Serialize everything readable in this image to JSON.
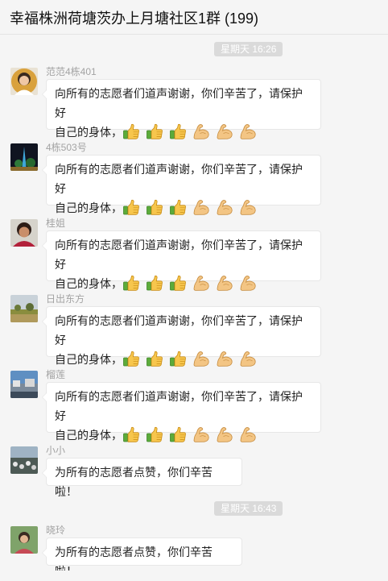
{
  "header": {
    "title": "幸福株洲荷塘茨办上月塘社区1群 (199)"
  },
  "time_badges": [
    "星期天 16:26",
    "星期天 16:43"
  ],
  "messages": [
    {
      "sender": "范范4栋401",
      "line1": "向所有的志愿者们道声谢谢，你们辛苦了，请保护好",
      "line2": "自己的身体，",
      "emoji": [
        "thumbs-up",
        "thumbs-up",
        "thumbs-up",
        "flexed-biceps",
        "flexed-biceps",
        "flexed-biceps"
      ]
    },
    {
      "sender": "4栋503号",
      "line1": "向所有的志愿者们道声谢谢，你们辛苦了，请保护好",
      "line2": "自己的身体，",
      "emoji": [
        "thumbs-up",
        "thumbs-up",
        "thumbs-up",
        "flexed-biceps",
        "flexed-biceps",
        "flexed-biceps"
      ]
    },
    {
      "sender": "桂姐",
      "line1": "向所有的志愿者们道声谢谢，你们辛苦了，请保护好",
      "line2": "自己的身体，",
      "emoji": [
        "thumbs-up",
        "thumbs-up",
        "thumbs-up",
        "flexed-biceps",
        "flexed-biceps",
        "flexed-biceps"
      ]
    },
    {
      "sender": "日出东方",
      "line1": "向所有的志愿者们道声谢谢，你们辛苦了，请保护好",
      "line2": "自己的身体，",
      "emoji": [
        "thumbs-up",
        "thumbs-up",
        "thumbs-up",
        "flexed-biceps",
        "flexed-biceps",
        "flexed-biceps"
      ]
    },
    {
      "sender": "榴莲",
      "line1": "向所有的志愿者们道声谢谢，你们辛苦了，请保护好",
      "line2": "自己的身体，",
      "emoji": [
        "thumbs-up",
        "thumbs-up",
        "thumbs-up",
        "flexed-biceps",
        "flexed-biceps",
        "flexed-biceps"
      ]
    },
    {
      "sender": "小小",
      "text": "为所有的志愿者点赞，你们辛苦啦！"
    },
    {
      "sender": "晓玲",
      "text": "为所有的志愿者点赞，你们辛苦啦！"
    }
  ],
  "colors": {
    "background": "#f5f5f5",
    "bubble": "#ffffff",
    "sender_text": "#a3a3a3",
    "badge": "#dadada"
  }
}
